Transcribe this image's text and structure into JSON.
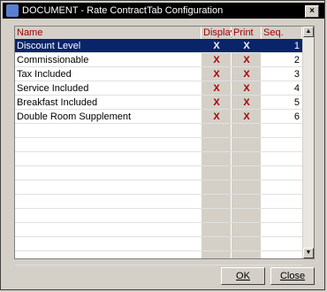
{
  "window": {
    "title": "DOCUMENT - Rate ContractTab Configuration",
    "close_label": "×"
  },
  "grid": {
    "headers": {
      "name": "Name",
      "display": "Display",
      "print": "Print",
      "seq": "Seq."
    },
    "rows": [
      {
        "name": "Discount Level",
        "display": "X",
        "print": "X",
        "seq": "1",
        "selected": true
      },
      {
        "name": "Commissionable",
        "display": "X",
        "print": "X",
        "seq": "2"
      },
      {
        "name": "Tax Included",
        "display": "X",
        "print": "X",
        "seq": "3"
      },
      {
        "name": "Service Included",
        "display": "X",
        "print": "X",
        "seq": "4"
      },
      {
        "name": "Breakfast Included",
        "display": "X",
        "print": "X",
        "seq": "5"
      },
      {
        "name": "Double Room Supplement",
        "display": "X",
        "print": "X",
        "seq": "6"
      }
    ],
    "empty_rows": 10
  },
  "scrollbar": {
    "up_arrow": "▲",
    "down_arrow": "▼"
  },
  "buttons": {
    "ok_label": "OK",
    "close_label": "Close"
  },
  "colors": {
    "selection": "#0a246a",
    "header_text": "#a00000",
    "marker_text": "#a00000"
  }
}
